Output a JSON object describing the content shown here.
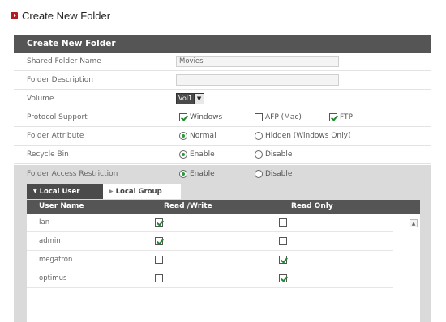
{
  "page": {
    "title": "Create New Folder"
  },
  "panel": {
    "header": "Create New Folder",
    "rows": {
      "shared_name": {
        "label": "Shared Folder Name",
        "value": "Movies"
      },
      "description": {
        "label": "Folder Description",
        "value": ""
      },
      "volume": {
        "label": "Volume",
        "value": "Vol1"
      },
      "protocol": {
        "label": "Protocol Support",
        "options": [
          {
            "label": "Windows",
            "checked": true
          },
          {
            "label": "AFP (Mac)",
            "checked": false
          },
          {
            "label": "FTP",
            "checked": true
          }
        ]
      },
      "attribute": {
        "label": "Folder Attribute",
        "options": [
          {
            "label": "Normal",
            "selected": true
          },
          {
            "label": "Hidden (Windows Only)",
            "selected": false
          }
        ]
      },
      "recycle": {
        "label": "Recycle Bin",
        "options": [
          {
            "label": "Enable",
            "selected": true
          },
          {
            "label": "Disable",
            "selected": false
          }
        ]
      },
      "access": {
        "label": "Folder Access Restriction",
        "options": [
          {
            "label": "Enable",
            "selected": true
          },
          {
            "label": "Disable",
            "selected": false
          }
        ]
      }
    }
  },
  "tabs": {
    "local_user": "Local User",
    "local_group": "Local Group"
  },
  "table": {
    "headers": {
      "user": "User Name",
      "rw": "Read /Write",
      "ro": "Read Only"
    },
    "rows": [
      {
        "name": "Ian",
        "rw": true,
        "ro": false
      },
      {
        "name": "admin",
        "rw": true,
        "ro": false
      },
      {
        "name": "megatron",
        "rw": false,
        "ro": true
      },
      {
        "name": "optimus",
        "rw": false,
        "ro": true
      }
    ]
  },
  "icons": {
    "title_marker": "arrow-box-icon",
    "dropdown": "chevron-down-icon",
    "tab_caret": "caret-down-icon",
    "tab_arrow": "caret-right-icon",
    "scroll": "scroll-up-icon"
  },
  "colors": {
    "header_bg": "#555555",
    "accent_red": "#b01c22",
    "check_green": "#1e8a2b",
    "access_bg": "#dadada"
  }
}
